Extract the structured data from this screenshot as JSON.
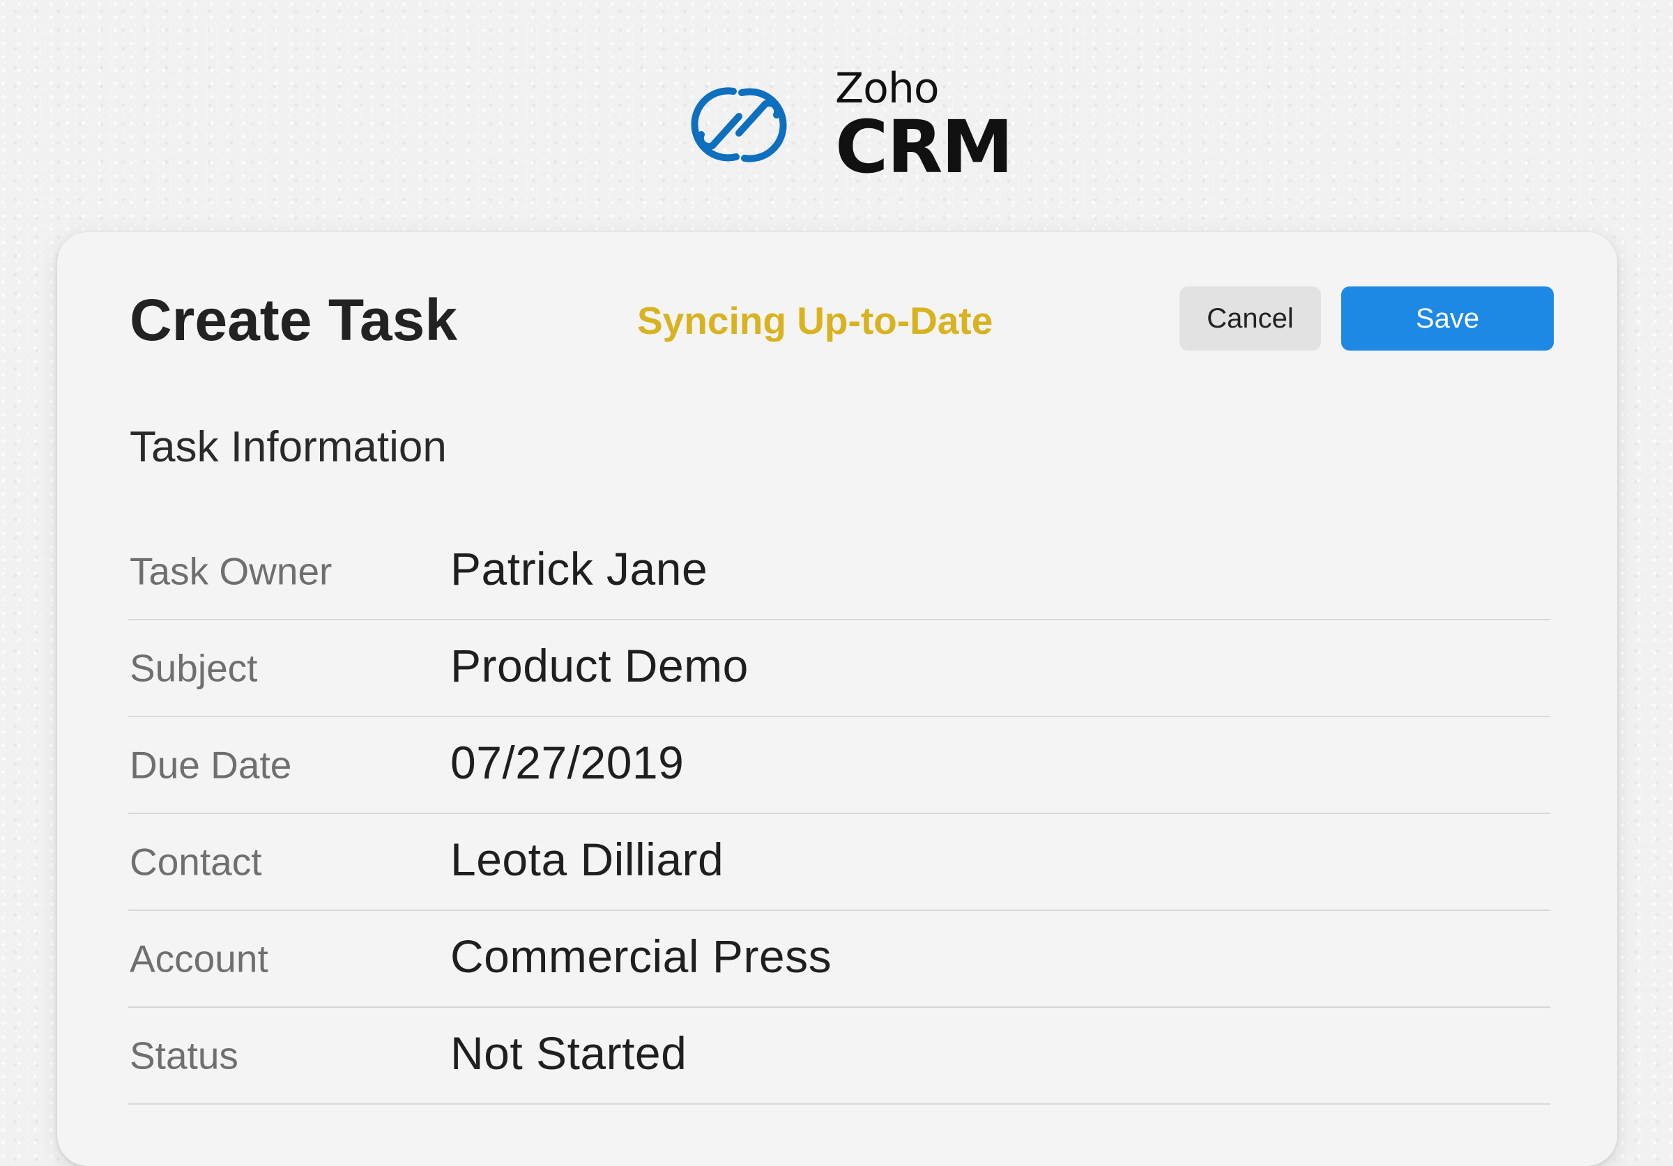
{
  "logo": {
    "brand_top": "Zoho",
    "brand_bottom": "CRM",
    "icon": "zoho-links-icon",
    "color": "#0f6fbf"
  },
  "form": {
    "title": "Create Task",
    "sync_status": "Syncing Up-to-Date",
    "sync_color": "#d9b21f",
    "cancel_label": "Cancel",
    "save_label": "Save",
    "save_color": "#1e88e5",
    "section_title": "Task Information",
    "fields": [
      {
        "label": "Task Owner",
        "value": "Patrick Jane"
      },
      {
        "label": "Subject",
        "value": "Product Demo"
      },
      {
        "label": "Due Date",
        "value": "07/27/2019"
      },
      {
        "label": "Contact",
        "value": "Leota Dilliard"
      },
      {
        "label": "Account",
        "value": "Commercial Press"
      },
      {
        "label": "Status",
        "value": "Not Started"
      }
    ]
  }
}
